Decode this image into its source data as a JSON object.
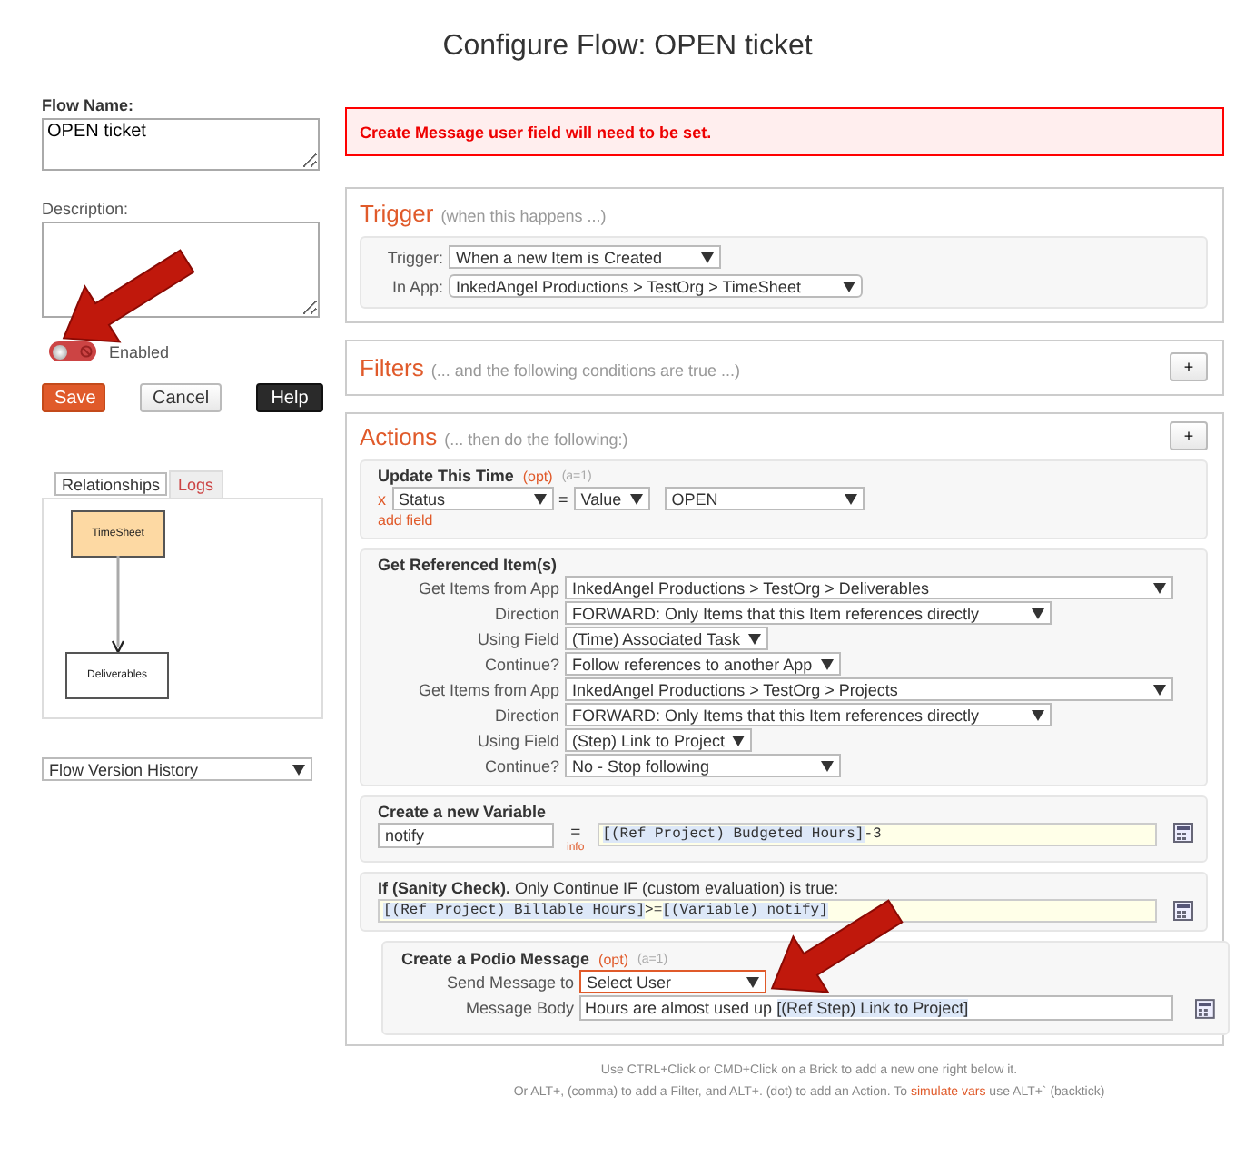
{
  "title": "Configure Flow: OPEN ticket",
  "flow_name": {
    "label": "Flow Name:",
    "value": "OPEN ticket"
  },
  "description": {
    "label": "Description:"
  },
  "toggle": {
    "label": "Enabled",
    "on": false
  },
  "buttons": [
    {
      "label": "Save",
      "kind": "primary"
    },
    {
      "label": "Cancel",
      "kind": "default"
    },
    {
      "label": "Help",
      "kind": "dark"
    }
  ],
  "tabs": [
    {
      "label": "Relationships",
      "selected": true
    },
    {
      "label": "Logs",
      "selected": false
    }
  ],
  "diagram": {
    "nodes": [
      {
        "label": "TimeSheet",
        "kind": "source"
      },
      {
        "label": "Deliverables",
        "kind": "target"
      }
    ]
  },
  "version_select": {
    "value": "Flow Version History"
  },
  "error": "Create Message user field will need to be set.",
  "trigger": {
    "title": "Trigger",
    "hint": "(when this happens ...)",
    "rows": [
      {
        "label": "Trigger:",
        "value": "When a new Item is Created"
      },
      {
        "label": "In App:",
        "value": "InkedAngel Productions > TestOrg > TimeSheet"
      }
    ]
  },
  "filters": {
    "title": "Filters",
    "hint": "(... and the following conditions are true ...)",
    "add_button": "+"
  },
  "actions": {
    "title": "Actions",
    "hint": "(... then do the following:)",
    "add_button": "+",
    "update": {
      "title": "Update This Time",
      "opt": "(opt)",
      "count": "(a=1)",
      "remove": "x",
      "field": "Status",
      "equals": "=",
      "mode": "Value",
      "value": "OPEN",
      "add_link": "add field"
    },
    "referenced": {
      "title": "Get Referenced Item(s)",
      "rows": [
        {
          "label": "Get Items from App",
          "value": "InkedAngel Productions > TestOrg > Deliverables"
        },
        {
          "label": "Direction",
          "value": "FORWARD: Only Items that this Item references directly"
        },
        {
          "label": "Using Field",
          "value": "(Time) Associated Task"
        },
        {
          "label": "Continue?",
          "value": "Follow references to another App"
        },
        {
          "label": "Get Items from App",
          "value": "InkedAngel Productions > TestOrg > Projects"
        },
        {
          "label": "Direction",
          "value": "FORWARD: Only Items that this Item references directly"
        },
        {
          "label": "Using Field",
          "value": "(Step) Link to Project"
        },
        {
          "label": "Continue?",
          "value": "No - Stop following"
        }
      ]
    },
    "variable": {
      "title": "Create a new Variable",
      "name": "notify",
      "equals": "=",
      "info": "info",
      "formula": [
        {
          "text": "[(Ref Project) Budgeted Hours]",
          "token": true
        },
        {
          "text": "-3",
          "token": false
        }
      ]
    },
    "sanity": {
      "title": "**If (Sanity Check).** Only Continue IF (custom evaluation) is true:",
      "formula": [
        {
          "text": "[(Ref Project) Billable Hours]",
          "token": true
        },
        {
          "text": ">=",
          "token": false
        },
        {
          "text": "[(Variable) notify]",
          "token": true
        }
      ]
    },
    "message": {
      "title": "Create a Podio Message",
      "opt": "(opt)",
      "count": "(a=1)",
      "to_label": "Send Message to",
      "to_value": "Select User",
      "to_highlighted": true,
      "body_label": "Message Body",
      "body": [
        {
          "text": "Hours are almost used up ",
          "token": false
        },
        {
          "text": "[(Ref Step) Link to Project]",
          "token": true
        }
      ]
    }
  },
  "footer": {
    "line1": "Use CTRL+Click or CMD+Click on a Brick to add a new one right below it.",
    "line2_before": "Or ALT+, (comma) to add a Filter, and ALT+. (dot) to add an Action. To ",
    "link": "simulate vars",
    "line2_after": " use ALT+` (backtick)"
  }
}
